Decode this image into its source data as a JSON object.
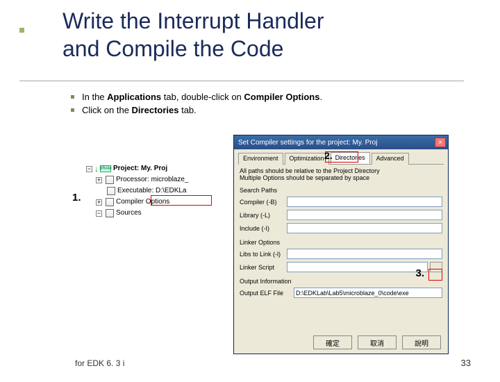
{
  "slide": {
    "title_line1": "Write the Interrupt Handler",
    "title_line2": "and Compile the Code",
    "bullet1_pre": "In the ",
    "bullet1_b1": "Applications",
    "bullet1_mid": " tab, double-click on ",
    "bullet1_b2": "Compiler Options",
    "bullet1_post": ".",
    "bullet2_pre": "Click on the ",
    "bullet2_b1": "Directories",
    "bullet2_post": " tab.",
    "footer_left": "for EDK 6. 3 i",
    "page_num": "33"
  },
  "callouts": {
    "c1": "1.",
    "c2": "2.",
    "c3": "3."
  },
  "tree": {
    "bram": "BRAM",
    "proj_label": "Project: ",
    "proj_name": "My. Proj",
    "proc": "Processor: microblaze_",
    "exe": "Executable: D:\\EDKLa",
    "compopts": "Compiler Options",
    "sources": "Sources",
    "plus": "+",
    "minus": "−"
  },
  "dialog": {
    "title": "Set Compiler settings for the project: My. Proj",
    "tabs": {
      "env": "Environment",
      "opt": "Optimization",
      "dir": "Directories",
      "adv": "Advanced"
    },
    "info1": "All paths should be relative to the Project Directory",
    "info2": "Multiple Options should be separated by space",
    "search_paths": "Search Paths",
    "compiler": "Compiler (-B)",
    "library": "Library (-L)",
    "include": "Include (-I)",
    "linker_opts": "Linker Options",
    "libs_link": "Libs to Link (-l)",
    "linker_script": "Linker Script",
    "output_info": "Output Information",
    "output_elf": "Output ELF File",
    "output_elf_val": "D:\\EDKLab\\Lab5\\microblaze_0\\code\\exe",
    "browse": "...",
    "ok": "確定",
    "cancel": "取消",
    "help": "說明",
    "close": "×"
  }
}
